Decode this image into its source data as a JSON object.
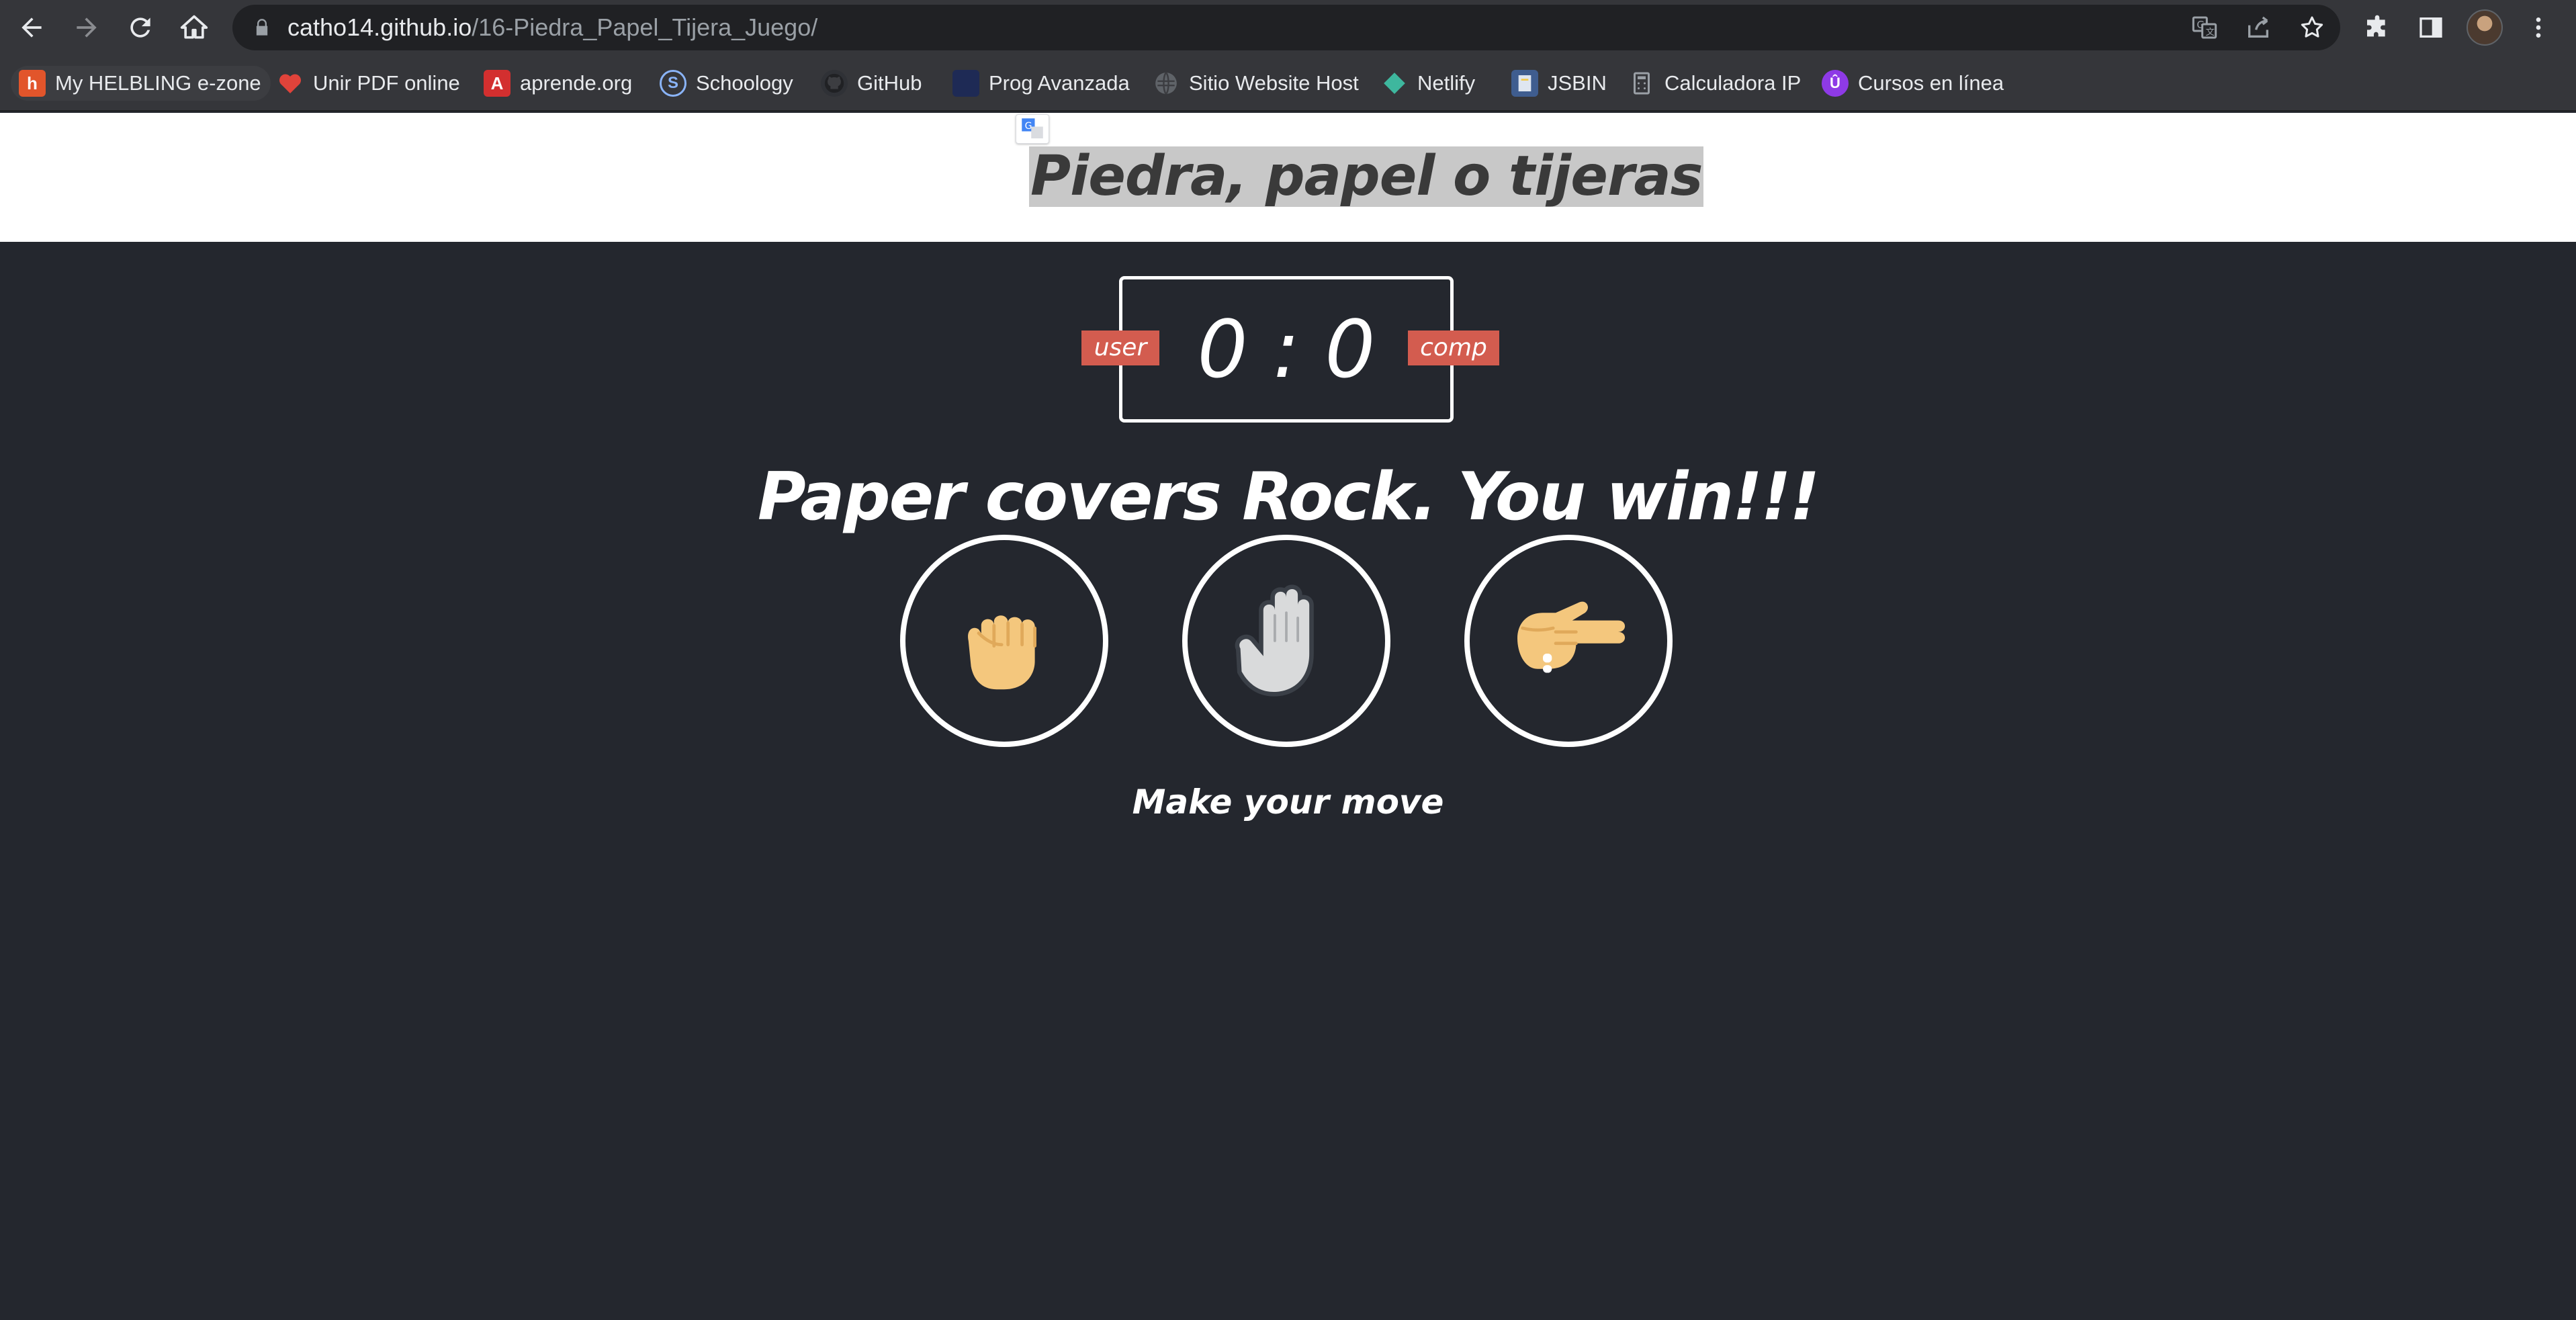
{
  "browser": {
    "url_host": "catho14.github.io",
    "url_path": "/16-Piedra_Papel_Tijera_Juego/"
  },
  "bookmarks": [
    {
      "label": "My HELBLING e-zone",
      "icon": "helbling-icon",
      "color": "#e2552b"
    },
    {
      "label": "Unir PDF online",
      "icon": "heart-icon",
      "color": "#e0433a"
    },
    {
      "label": "aprende.org",
      "icon": "aprende-icon",
      "color": "#d32f2f"
    },
    {
      "label": "Schoology",
      "icon": "schoology-icon",
      "color": "#2c88c9"
    },
    {
      "label": "GitHub",
      "icon": "github-icon",
      "color": "#2f3136"
    },
    {
      "label": "Prog Avanzada",
      "icon": "bookmark-icon",
      "color": "#1e2a55"
    },
    {
      "label": "Sitio Website Host",
      "icon": "globe-icon",
      "color": "#5f6368"
    },
    {
      "label": "Netlify",
      "icon": "netlify-icon",
      "color": "#3eb79e"
    },
    {
      "label": "JSBIN",
      "icon": "jsbin-icon",
      "color": "#f2c94c"
    },
    {
      "label": "Calculadora IP",
      "icon": "calculator-icon",
      "color": "#9aa0a6"
    },
    {
      "label": "Cursos en línea",
      "icon": "cursos-icon",
      "color": "#8e3ae6"
    }
  ],
  "page": {
    "title": "Piedra, papel o tijeras",
    "score": {
      "user": 0,
      "separator": ":",
      "comp": 0,
      "display": "0 : 0"
    },
    "user_label": "user",
    "comp_label": "comp",
    "result": "Paper covers Rock. You win!!!",
    "choices": [
      {
        "name": "rock",
        "icon": "rock-hand-icon",
        "selected": false
      },
      {
        "name": "paper",
        "icon": "paper-hand-icon",
        "selected": true
      },
      {
        "name": "scissors",
        "icon": "scissors-hand-icon",
        "selected": false
      }
    ],
    "action": "Make your move"
  },
  "colors": {
    "page_bg": "#24272e",
    "badge": "#d35c4f",
    "skin": "#f4c77d",
    "selected_hand": "#d9dadb"
  }
}
